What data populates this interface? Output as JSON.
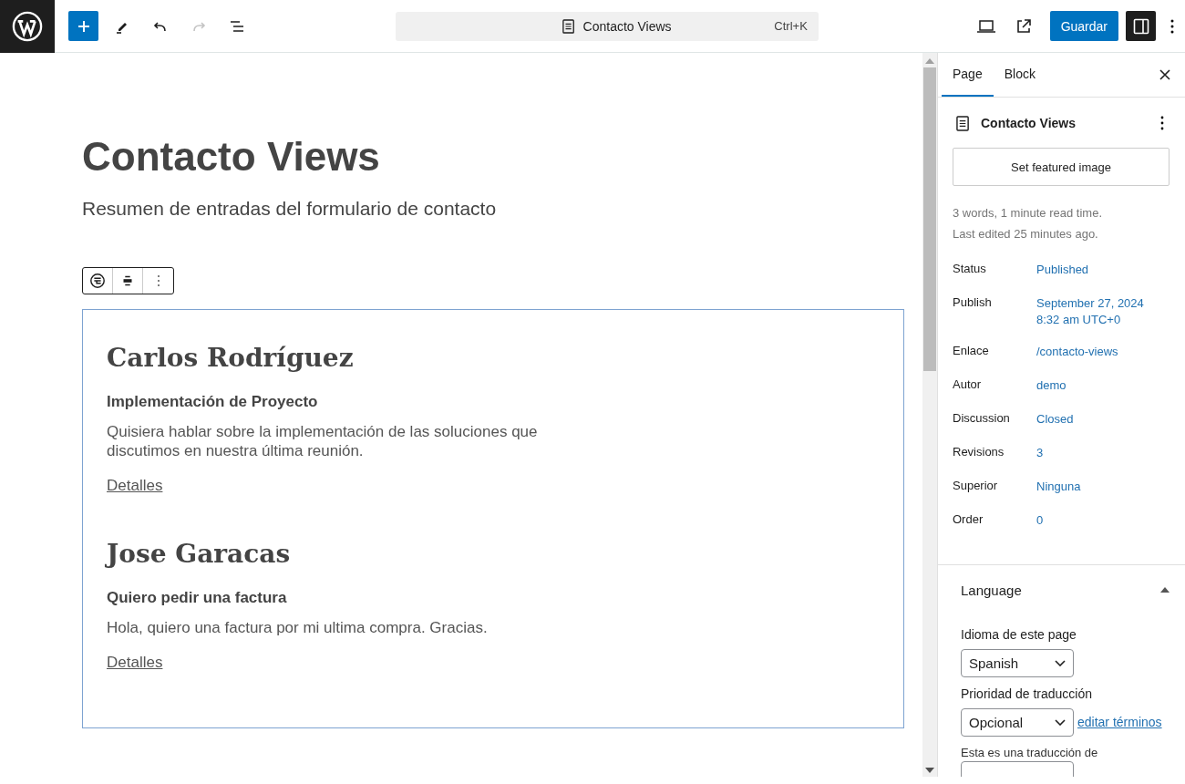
{
  "toolbar": {
    "tools": [
      {
        "kind": "add",
        "disabled": false
      },
      {
        "kind": "edit",
        "disabled": false
      },
      {
        "kind": "undo",
        "disabled": false
      },
      {
        "kind": "redo",
        "disabled": true
      },
      {
        "kind": "outline",
        "disabled": false
      }
    ],
    "command_bar": {
      "label": "Contacto Views",
      "shortcut": "Ctrl+K"
    },
    "save_button": "Guardar",
    "settings_toggle": {
      "selected": true
    }
  },
  "editor": {
    "title": "Contacto Views",
    "subtitle": "Resumen de entradas del formulario de contacto",
    "entries": [
      {
        "name": "Carlos Rodríguez",
        "subject": "Implementación de Proyecto",
        "message": "Quisiera hablar sobre la implementación de las soluciones que discutimos en nuestra última reunión.",
        "link": "Detalles"
      },
      {
        "name": "Jose Garacas",
        "subject": "Quiero pedir una factura",
        "message": "Hola, quiero una factura por mi ultima compra. Gracias.",
        "link": "Detalles"
      }
    ]
  },
  "sidebar": {
    "tabs": [
      {
        "label": "Page",
        "selected": true
      },
      {
        "label": "Block",
        "selected": false
      }
    ],
    "document": {
      "title": "Contacto Views"
    },
    "featured_image_button": "Set featured image",
    "summary": [
      "3 words, 1 minute read time.",
      "Last edited 25 minutes ago."
    ],
    "fields": [
      {
        "label": "Status",
        "value": "Published"
      },
      {
        "label": "Publish",
        "value": "September 27, 2024 8:32 am UTC+0"
      },
      {
        "label": "Enlace",
        "value": "/contacto-views"
      },
      {
        "label": "Autor",
        "value": "demo"
      },
      {
        "label": "Discussion",
        "value": "Closed"
      },
      {
        "label": "Revisions",
        "value": "3"
      },
      {
        "label": "Superior",
        "value": "Ninguna"
      },
      {
        "label": "Order",
        "value": "0"
      }
    ],
    "language": {
      "title": "Language",
      "expanded": true,
      "language_label": "Idioma de este page",
      "language_value": "Spanish",
      "priority_label": "Prioridad de traducción",
      "priority_value": "Opcional",
      "edit_link": "editar términos",
      "translation_label": "Esta es una traducción de"
    }
  }
}
